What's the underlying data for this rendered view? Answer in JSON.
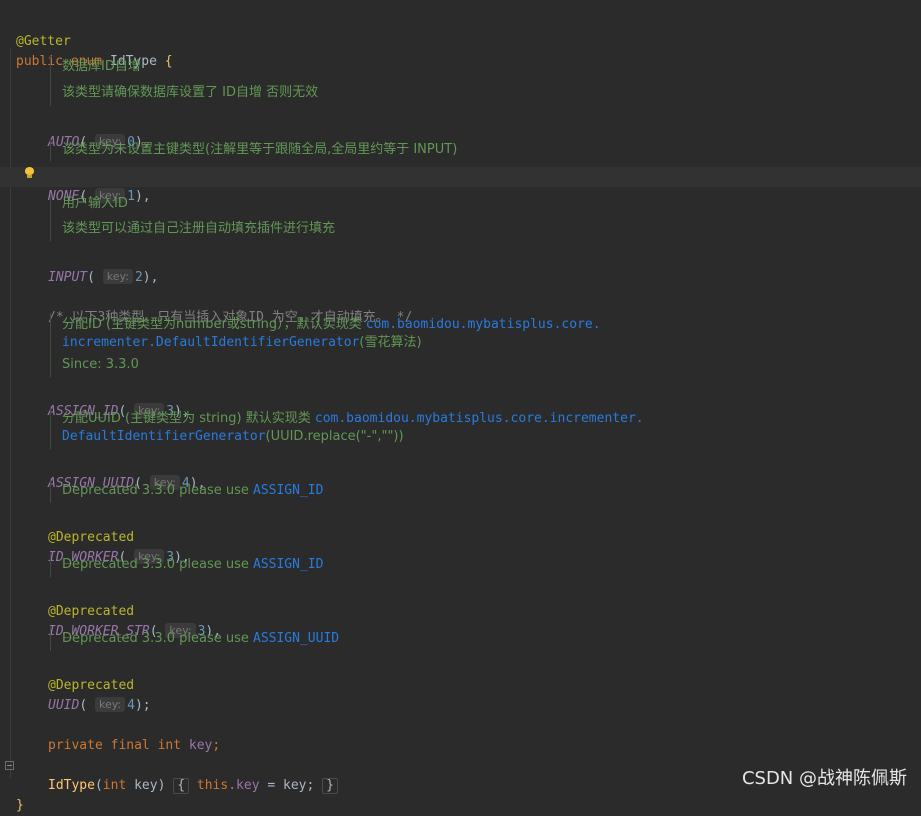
{
  "code": {
    "annotation_getter": "@Getter",
    "decl_public": "public",
    "decl_enum": "enum",
    "decl_name": "IdType",
    "decl_brace": " {",
    "hint_key": "key:",
    "auto": {
      "name": "AUTO",
      "value": "0",
      "doc": [
        "数据库ID自增",
        "该类型请确保数据库设置了 ID自增 否则无效"
      ]
    },
    "none": {
      "name": "NONE",
      "value": "1",
      "doc": [
        "该类型为未设置主键类型(注解里等于跟随全局,全局里约等于 INPUT)"
      ]
    },
    "input": {
      "name": "INPUT",
      "value": "2",
      "doc": [
        "用户输入ID",
        "该类型可以通过自己注册自动填充插件进行填充"
      ]
    },
    "comment": "/* 以下3种类型、只有当插入对象ID 为空，才自动填充。 */",
    "assign_id": {
      "name": "ASSIGN_ID",
      "value": "3",
      "doc1_prefix": "分配ID (主键类型为number或string），默认实现类 ",
      "doc1_link": "com.baomidou.mybatisplus.core.",
      "doc2_link": "incrementer.DefaultIdentifierGenerator",
      "doc2_suffix": "(雪花算法)",
      "doc3": "Since: 3.3.0"
    },
    "assign_uuid": {
      "name": "ASSIGN_UUID",
      "value": "4",
      "doc1_prefix": "分配UUID (主键类型为 string) 默认实现类 ",
      "doc1_link": "com.baomidou.mybatisplus.core.incrementer.",
      "doc2_link": "DefaultIdentifierGenerator",
      "doc2_suffix": "(UUID.replace(\"-\",\"\"))"
    },
    "deprecated_text": "Deprecated 3.3.0 please use ",
    "deprecated_annotation": "@Deprecated",
    "id_worker": {
      "name": "ID_WORKER",
      "value": "3",
      "use": "ASSIGN_ID"
    },
    "id_worker_str": {
      "name": "ID_WORKER_STR",
      "value": "3",
      "use": "ASSIGN_UUID"
    },
    "uuid": {
      "name": "UUID",
      "value": "4",
      "use": "ASSIGN_ID"
    },
    "field_private": "private",
    "field_final": "final",
    "field_int": "int",
    "field_key": "key",
    "ctor_name": "IdType",
    "ctor_int": "int",
    "ctor_param": " key) ",
    "ctor_this": "this",
    "ctor_key": ".key",
    "ctor_assign": " = key;",
    "closing": "}"
  },
  "watermark": "CSDN @战神陈佩斯"
}
